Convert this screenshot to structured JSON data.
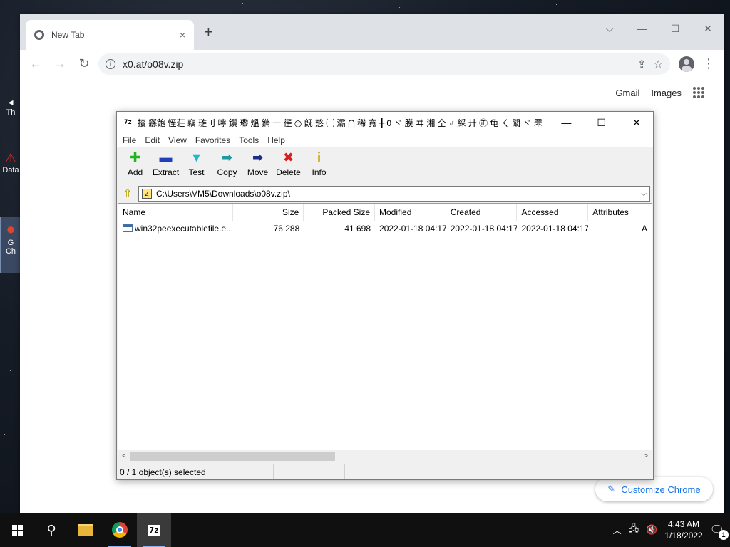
{
  "desktop": {
    "icons": [
      {
        "label": "Th"
      },
      {
        "label": "Data"
      },
      {
        "label": "G\nCh"
      }
    ]
  },
  "chrome": {
    "tab": {
      "title": "New Tab",
      "close": "×"
    },
    "new_tab": "+",
    "window_controls": {
      "dropdown": "⌵",
      "minimize": "—",
      "maximize": "☐",
      "close": "✕"
    },
    "toolbar": {
      "back": "←",
      "forward": "→",
      "reload": "↻",
      "url": "x0.at/o08v.zip",
      "share": "⇪",
      "bookmark": "☆",
      "menu": "⋮"
    },
    "page": {
      "gmail": "Gmail",
      "images": "Images",
      "customize": "Customize Chrome",
      "customize_icon": "✎"
    }
  },
  "zip_window": {
    "logo": "7z",
    "title": "擯 繇飽 恎荘 竊 璡刂 嚀 鑕 瓈 熅 鏅 ㆒ 徰 ◎ 旣 慜 ㈠ 灞 ⋂ 稀 寬 ╂ 0 ヾ 膜 ヰ 湘 仝 ♂ 綵 廾 ㊣ 龟 ㄑ 闞 ヾ 罘",
    "controls": {
      "minimize": "—",
      "maximize": "☐",
      "close": "✕"
    },
    "menu": [
      "File",
      "Edit",
      "View",
      "Favorites",
      "Tools",
      "Help"
    ],
    "tools": [
      {
        "label": "Add",
        "icon": "plus-icon",
        "glyph": "✚",
        "color": "#22b422"
      },
      {
        "label": "Extract",
        "icon": "minus-icon",
        "glyph": "▬",
        "color": "#1f3fbf"
      },
      {
        "label": "Test",
        "icon": "check-icon",
        "glyph": "▼",
        "color": "#23b5c9"
      },
      {
        "label": "Copy",
        "icon": "copy-arrow-icon",
        "glyph": "➡",
        "color": "#1e9aa0"
      },
      {
        "label": "Move",
        "icon": "move-arrow-icon",
        "glyph": "➡",
        "color": "#1b2e8a"
      },
      {
        "label": "Delete",
        "icon": "delete-icon",
        "glyph": "✖",
        "color": "#d81e1e"
      },
      {
        "label": "Info",
        "icon": "info-icon",
        "glyph": "i",
        "color": "#c7a400"
      }
    ],
    "path": "C:\\Users\\VM5\\Downloads\\o08v.zip\\",
    "columns": [
      "Name",
      "Size",
      "Packed Size",
      "Modified",
      "Created",
      "Accessed",
      "Attributes"
    ],
    "rows": [
      {
        "name": "win32peexecutablefile.e...",
        "size": "76 288",
        "packed": "41 698",
        "modified": "2022-01-18 04:17",
        "created": "2022-01-18 04:17",
        "accessed": "2022-01-18 04:17",
        "attributes": "A"
      }
    ],
    "scroll": {
      "left": "<",
      "right": ">"
    },
    "status": "0 / 1 object(s) selected"
  },
  "taskbar": {
    "zip_label": "7z",
    "time": "4:43 AM",
    "date": "1/18/2022",
    "notification_count": "1"
  }
}
